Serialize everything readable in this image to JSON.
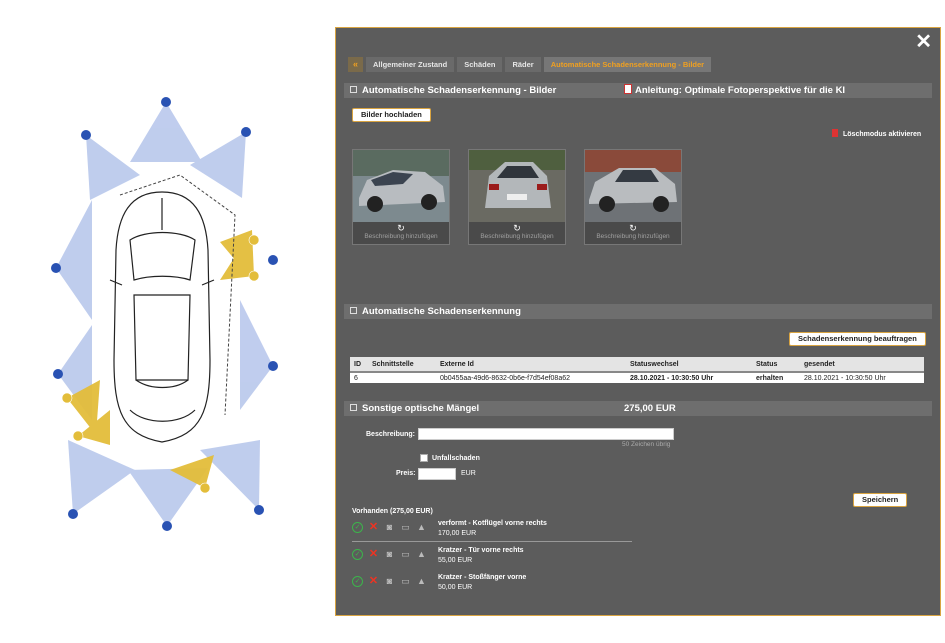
{
  "modal": {
    "close_label": "✕",
    "tabs": [
      {
        "label": "«"
      },
      {
        "label": "Allgemeiner Zustand"
      },
      {
        "label": "Schäden"
      },
      {
        "label": "Räder"
      },
      {
        "label": "Automatische Schadenserkennung - Bilder"
      }
    ],
    "active_tab": 4
  },
  "images_section": {
    "title": "Automatische Schadenserkennung - Bilder",
    "guide_link": "Anleitung: Optimale Fotoperspektive für die KI",
    "upload_button": "Bilder hochladen",
    "delete_mode": "Löschmodus aktivieren",
    "thumbnails": [
      {
        "rotate_icon": "↻",
        "description_placeholder": "Beschreibung hinzufügen"
      },
      {
        "rotate_icon": "↻",
        "description_placeholder": "Beschreibung hinzufügen"
      },
      {
        "rotate_icon": "↻",
        "description_placeholder": "Beschreibung hinzufügen"
      }
    ]
  },
  "detection_section": {
    "title": "Automatische Schadenserkennung",
    "order_button": "Schadenserkennung beauftragen",
    "columns": [
      "ID",
      "Schnittstelle",
      "Externe Id",
      "Statuswechsel",
      "Status",
      "gesendet"
    ],
    "rows": [
      [
        "6",
        "",
        "0b0455aa-49d6-8632-0b6e-f7d54ef08a62",
        "28.10.2021 - 10:30:50 Uhr",
        "erhalten",
        "28.10.2021 - 10:30:50 Uhr"
      ]
    ]
  },
  "other_section": {
    "title": "Sonstige optische Mängel",
    "total": "275,00 EUR",
    "description_label": "Beschreibung:",
    "chars_left": "50 Zeichen übrig",
    "accident_label": "Unfallschaden",
    "price_label": "Preis:",
    "currency": "EUR",
    "save_button": "Speichern",
    "available_label": "Vorhanden (275,00 EUR)",
    "items": [
      {
        "title": "verformt - Kotflügel vorne rechts",
        "price": "170,00 EUR"
      },
      {
        "title": "Kratzer - Tür vorne rechts",
        "price": "55,00 EUR"
      },
      {
        "title": "Kratzer - Stoßfänger vorne",
        "price": "50,00 EUR"
      }
    ]
  },
  "colors": {
    "modal_bg": "#5c5c5c",
    "accent": "#f0a020",
    "camera_cone_blue": "#b9c8ec",
    "camera_cone_yellow": "#e3bd3a",
    "camera_marker": "#2952b3"
  }
}
